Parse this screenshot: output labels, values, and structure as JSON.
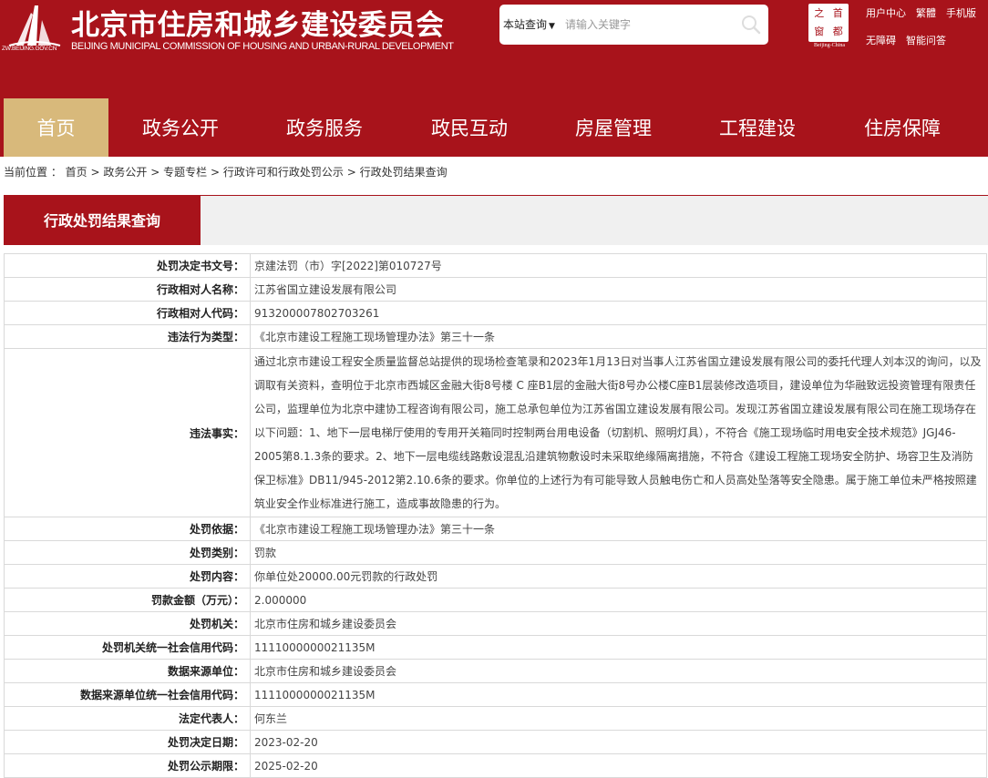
{
  "header": {
    "domain": "ZW.BEIJING.GOV.CN",
    "title": "北京市住房和城乡建设委员会",
    "subtitle": "BEIJING MUNICIPAL COMMISSION OF HOUSING AND URBAN-RURAL DEVELOPMENT",
    "search": {
      "scope": "本站查询",
      "placeholder": "请输入关键字"
    },
    "capital_logo": {
      "chars": [
        "之",
        "首",
        "窗",
        "都"
      ],
      "caption": "Beijing-China"
    },
    "links": [
      "用户中心",
      "繁體",
      "手机版",
      "无障碍",
      "智能问答"
    ]
  },
  "nav": {
    "items": [
      "首页",
      "政务公开",
      "政务服务",
      "政民互动",
      "房屋管理",
      "工程建设",
      "住房保障"
    ],
    "active_index": 0
  },
  "breadcrumb": {
    "prefix": "当前位置 ：",
    "items": [
      "首页",
      "政务公开",
      "专题专栏",
      "行政许可和行政处罚公示",
      "行政处罚结果查询"
    ],
    "separator": ">"
  },
  "section": {
    "title": "行政处罚结果查询"
  },
  "record": [
    {
      "label": "处罚决定书文号：",
      "value": "京建法罚（市）字[2022]第010727号"
    },
    {
      "label": "行政相对人名称：",
      "value": "江苏省国立建设发展有限公司"
    },
    {
      "label": "行政相对人代码：",
      "value": "913200007802703261"
    },
    {
      "label": "违法行为类型：",
      "value": "《北京市建设工程施工现场管理办法》第三十一条"
    },
    {
      "label": "违法事实：",
      "value": "通过北京市建设工程安全质量监督总站提供的现场检查笔录和2023年1月13日对当事人江苏省国立建设发展有限公司的委托代理人刘本汉的询问，以及调取有关资料，查明位于北京市西城区金融大街8号楼 C 座B1层的金融大街8号办公楼C座B1层装修改造项目，建设单位为华融致远投资管理有限责任公司，监理单位为北京中建协工程咨询有限公司，施工总承包单位为江苏省国立建设发展有限公司。发现江苏省国立建设发展有限公司在施工现场存在以下问题：1、地下一层电梯厅使用的专用开关箱同时控制两台用电设备（切割机、照明灯具），不符合《施工现场临时用电安全技术规范》JGJ46-2005第8.1.3条的要求。2、地下一层电缆线路敷设混乱沿建筑物敷设时未采取绝缘隔离措施，不符合《建设工程施工现场安全防护、场容卫生及消防保卫标准》DB11/945-2012第2.10.6条的要求。你单位的上述行为有可能导致人员触电伤亡和人员高处坠落等安全隐患。属于施工单位未严格按照建筑业安全作业标准进行施工，造成事故隐患的行为。"
    },
    {
      "label": "处罚依据：",
      "value": "《北京市建设工程施工现场管理办法》第三十一条"
    },
    {
      "label": "处罚类别：",
      "value": "罚款"
    },
    {
      "label": "处罚内容：",
      "value": "你单位处20000.00元罚款的行政处罚"
    },
    {
      "label": "罚款金额（万元）：",
      "value": "2.000000"
    },
    {
      "label": "处罚机关：",
      "value": "北京市住房和城乡建设委员会"
    },
    {
      "label": "处罚机关统一社会信用代码：",
      "value": "1111000000021135M"
    },
    {
      "label": "数据来源单位：",
      "value": "北京市住房和城乡建设委员会"
    },
    {
      "label": "数据来源单位统一社会信用代码：",
      "value": "1111000000021135M"
    },
    {
      "label": "法定代表人：",
      "value": "何东兰"
    },
    {
      "label": "处罚决定日期：",
      "value": "2023-02-20"
    },
    {
      "label": "处罚公示期限：",
      "value": "2025-02-20"
    }
  ],
  "colors": {
    "brand_red": "#a8131b",
    "nav_active": "#d8b97b"
  }
}
